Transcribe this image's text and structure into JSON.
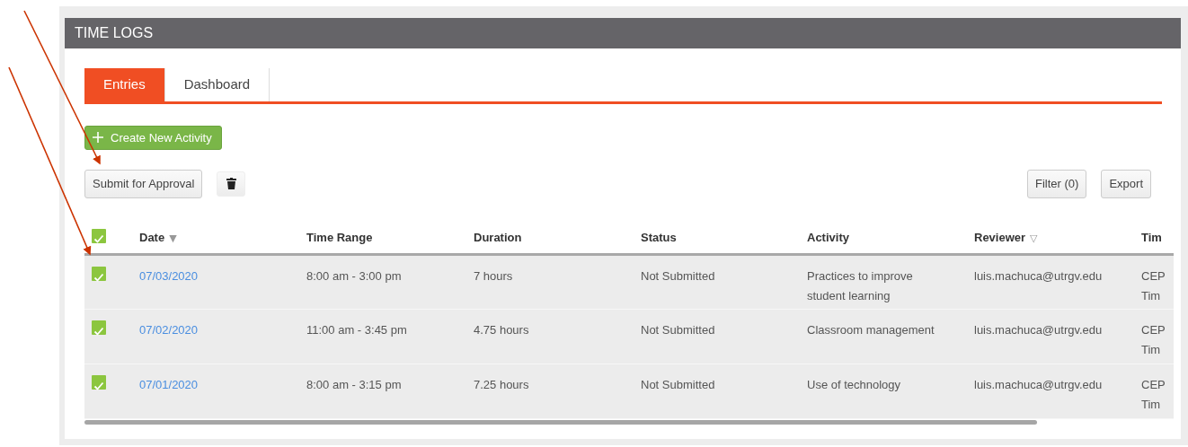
{
  "panel": {
    "title": "TIME LOGS"
  },
  "tabs": [
    {
      "label": "Entries",
      "selected": true
    },
    {
      "label": "Dashboard",
      "selected": false
    }
  ],
  "create_button": {
    "label": "Create New Activity"
  },
  "toolbar": {
    "submit_button": "Submit for Approval",
    "filter_button": "Filter (0)",
    "export_button": "Export"
  },
  "table": {
    "all_checked": true,
    "columns": [
      {
        "label": "Date",
        "sort": "▼"
      },
      {
        "label": "Time Range"
      },
      {
        "label": "Duration"
      },
      {
        "label": "Status"
      },
      {
        "label": "Activity"
      },
      {
        "label": "Reviewer",
        "sort": "▽"
      },
      {
        "label": "Tim"
      }
    ],
    "rows": [
      {
        "checked": true,
        "date": "07/03/2020",
        "time_range": "8:00 am - 3:00 pm",
        "duration": "7 hours",
        "status": "Not Submitted",
        "activity": "Practices to improve student learning",
        "reviewer": "luis.machuca@utrgv.edu",
        "column_8": [
          "CEP",
          "Tim"
        ]
      },
      {
        "checked": true,
        "date": "07/02/2020",
        "time_range": "11:00 am - 3:45 pm",
        "duration": "4.75 hours",
        "status": "Not Submitted",
        "activity": "Classroom management",
        "reviewer": "luis.machuca@utrgv.edu",
        "column_8": [
          "CEP",
          "Tim"
        ]
      },
      {
        "checked": true,
        "date": "07/01/2020",
        "time_range": "8:00 am - 3:15 pm",
        "duration": "7.25 hours",
        "status": "Not Submitted",
        "activity": "Use of technology",
        "reviewer": "luis.machuca@utrgv.edu",
        "column_8": [
          "CEP",
          "Tim"
        ]
      }
    ]
  },
  "annotations": [
    {
      "kind": "arrow"
    },
    {
      "kind": "arrow"
    }
  ]
}
